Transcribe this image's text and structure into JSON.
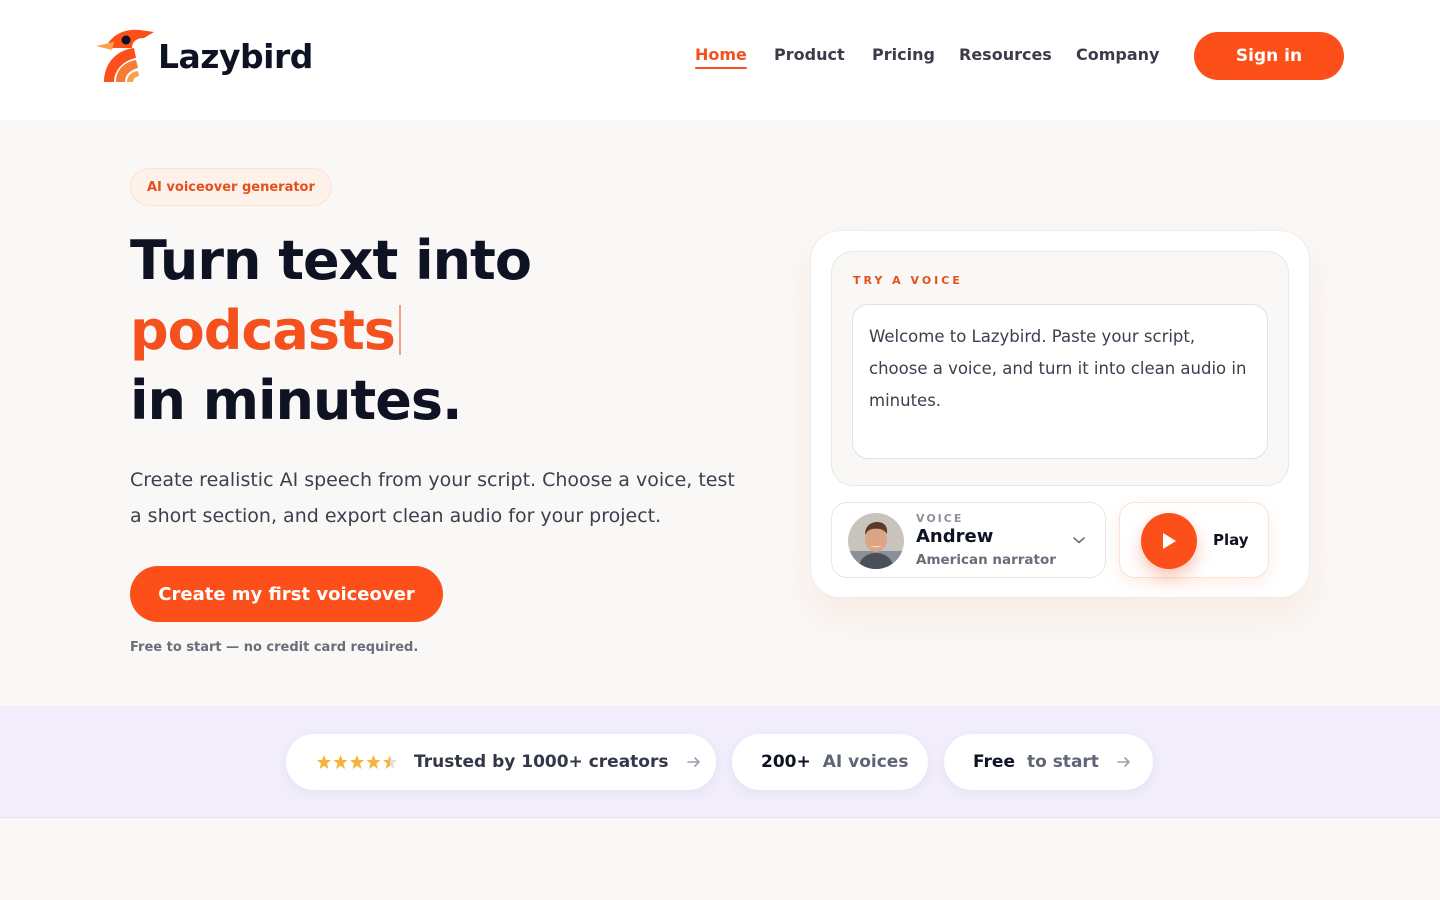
{
  "brand": {
    "name": "Lazybird",
    "accent": "#fc4f19"
  },
  "nav": {
    "items": [
      {
        "label": "Home",
        "active": true
      },
      {
        "label": "Product",
        "active": false
      },
      {
        "label": "Pricing",
        "active": false
      },
      {
        "label": "Resources",
        "active": false
      },
      {
        "label": "Company",
        "active": false
      }
    ],
    "signin_label": "Sign in"
  },
  "hero": {
    "badge": "AI voiceover generator",
    "headline_line1": "Turn text into",
    "headline_accent": "podcasts",
    "headline_line3": "in minutes.",
    "subtext": "Create realistic AI speech from your script. Choose a voice, test a short section, and export clean audio for your project.",
    "cta_label": "Create my first voiceover",
    "fineprint": "Free to start — no credit card required."
  },
  "voice_card": {
    "label": "TRY A VOICE",
    "script_text": "Welcome to Lazybird. Paste your script, choose a voice, and turn it into clean audio in minutes.",
    "voice_caption": "VOICE",
    "voice_name": "Andrew",
    "voice_desc": "American narrator",
    "play_label": "Play"
  },
  "stats": {
    "rating_stars": 4.5,
    "trusted": "Trusted by 1000+ creators",
    "voices_count": "200+",
    "voices_label": "AI voices",
    "free_strong": "Free",
    "free_label": "to start"
  }
}
